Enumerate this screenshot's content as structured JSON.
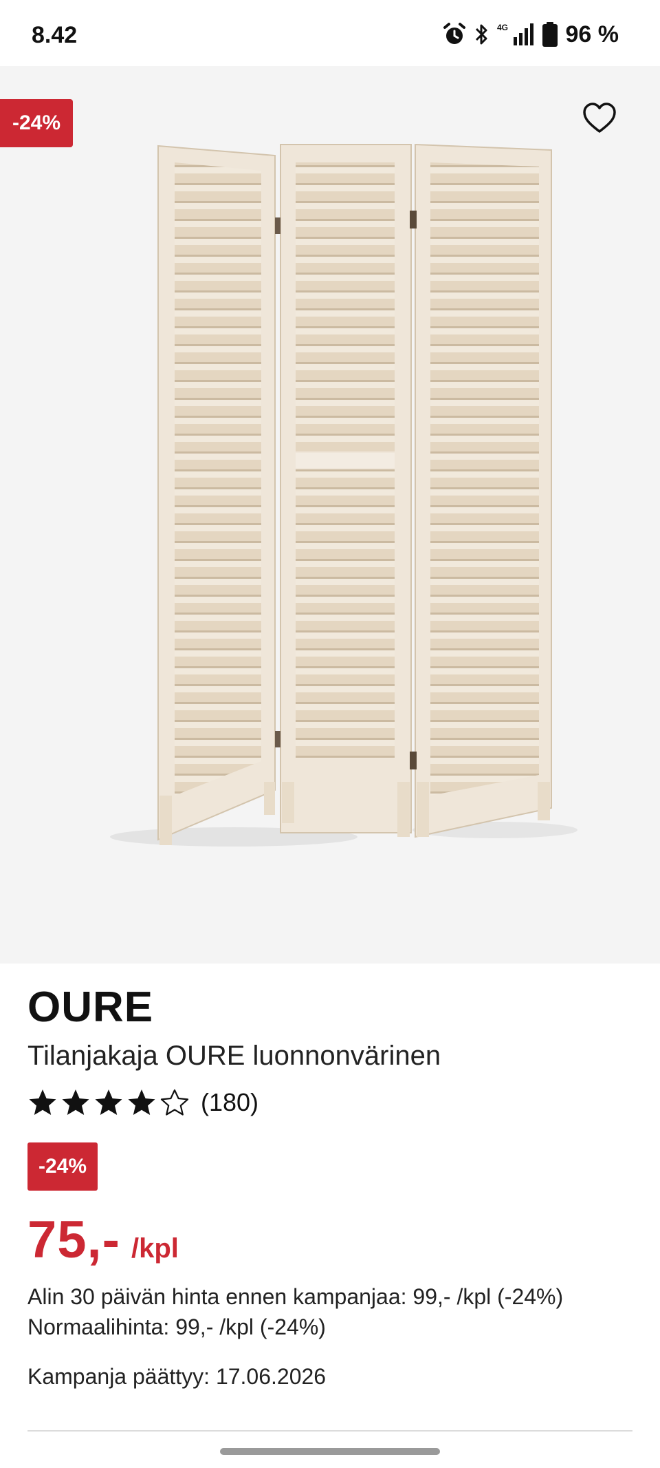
{
  "status_bar": {
    "time": "8.42",
    "network_label": "4G",
    "battery": "96 %",
    "icons": [
      "alarm-icon",
      "bluetooth-icon",
      "signal-icon",
      "battery-icon"
    ]
  },
  "hero": {
    "discount_badge": "-24%",
    "wishlist_icon": "heart-outline-icon",
    "image_description_icon": "room-divider-image"
  },
  "product": {
    "brand": "OURE",
    "name": "Tilanjakaja OURE luonnonvärinen",
    "rating": {
      "stars": 4,
      "max": 5,
      "count": "(180)"
    },
    "discount_badge": "-24%",
    "price": "75,-",
    "price_unit": "/kpl",
    "lowest_price_text": "Alin 30 päivän hinta ennen kampanjaa: 99,- /kpl (-24%)",
    "normal_price_text": "Normaalihinta: 99,- /kpl (-24%)",
    "campaign_end_text": "Kampanja päättyy: 17.06.2026"
  },
  "colors": {
    "accent_red": "#cc2833",
    "image_background": "#f4f4f4",
    "wood": "#e6dac8"
  }
}
